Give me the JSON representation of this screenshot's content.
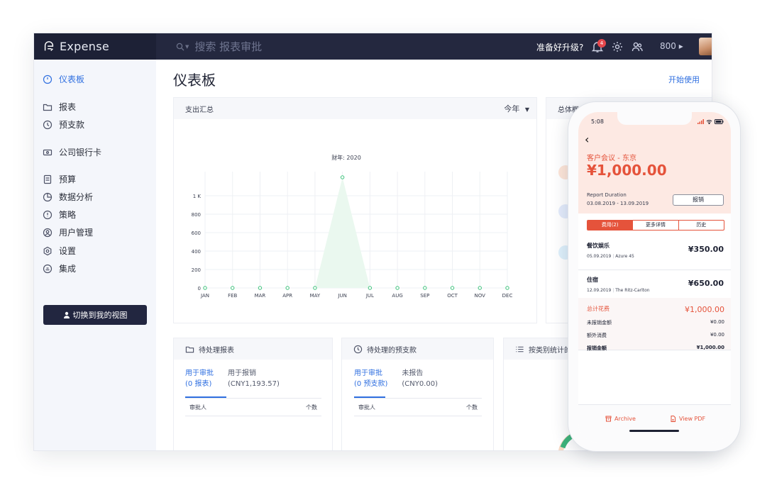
{
  "app": {
    "name": "Expense"
  },
  "topbar": {
    "search_placeholder": "搜索 报表审批",
    "upgrade_label": "准备好升级?",
    "notification_count": "4",
    "org_label": "800 ▸"
  },
  "sidebar": {
    "items": [
      {
        "label": "仪表板",
        "icon": "dashboard-icon"
      },
      {
        "label": "报表",
        "icon": "folder-icon"
      },
      {
        "label": "预支款",
        "icon": "clock-icon"
      },
      {
        "label": "公司银行卡",
        "icon": "card-icon"
      },
      {
        "label": "预算",
        "icon": "budget-icon"
      },
      {
        "label": "数据分析",
        "icon": "pie-icon"
      },
      {
        "label": "策略",
        "icon": "policy-icon"
      },
      {
        "label": "用户管理",
        "icon": "user-icon"
      },
      {
        "label": "设置",
        "icon": "gear-icon"
      },
      {
        "label": "集成",
        "icon": "integration-icon"
      }
    ],
    "switch_view_label": "切换到我的视图"
  },
  "main": {
    "title": "仪表板",
    "get_started": "开始使用",
    "spend_card": {
      "title": "支出汇总",
      "period": "今年",
      "chart_title": "财年: 2020"
    },
    "overview_card": {
      "title": "总体概"
    },
    "pending_reports": {
      "title": "待处理报表",
      "tab1_line1": "用于审批",
      "tab1_line2": "(0 报表)",
      "tab2_line1": "用于报销",
      "tab2_line2": "(CNY1,193.57)",
      "col_approver": "审批人",
      "col_count": "个数"
    },
    "pending_advances": {
      "title": "待处理的预支款",
      "tab1_line1": "用于审批",
      "tab1_line2": "(0 预支款)",
      "tab2_line1": "未报告",
      "tab2_line2": "(CNY0.00)",
      "col_approver": "审批人",
      "col_count": "个数"
    },
    "category_card": {
      "title": "按类别统计的"
    }
  },
  "chart_data": {
    "type": "area",
    "title": "财年: 2020",
    "categories": [
      "JAN",
      "FEB",
      "MAR",
      "APR",
      "MAY",
      "JUN",
      "JUL",
      "AUG",
      "SEP",
      "OCT",
      "NOV",
      "DEC"
    ],
    "values": [
      0,
      0,
      0,
      0,
      0,
      1200,
      0,
      0,
      0,
      0,
      0,
      0
    ],
    "y_ticks": [
      "0",
      "200",
      "400",
      "600",
      "800",
      "1 K"
    ],
    "ylim": [
      0,
      1200
    ],
    "grid": true,
    "series_color": "#3cc27a"
  },
  "phone": {
    "time": "5:08",
    "trip_name": "客户会议 - 东京",
    "amount": "¥1,000.00",
    "duration_label": "Report Duration",
    "duration_value": "03.08.2019 - 13.09.2019",
    "report_button": "报销",
    "tabs": [
      "费用(2)",
      "更多详情",
      "历史"
    ],
    "expenses": [
      {
        "category": "餐饮娱乐",
        "date": "05.09.2019",
        "merchant": "Azure 45",
        "amount": "¥350.00"
      },
      {
        "category": "住宿",
        "date": "12.09.2019",
        "merchant": "The Ritz-Carlton",
        "amount": "¥650.00"
      }
    ],
    "totals": [
      {
        "label": "总计花费",
        "value": "¥1,000.00"
      },
      {
        "label": "未报销金额",
        "value": "¥0.00"
      },
      {
        "label": "额外消费",
        "value": "¥0.00"
      },
      {
        "label": "报销金额",
        "value": "¥1,000.00"
      }
    ],
    "archive_label": "Archive",
    "view_pdf_label": "View PDF",
    "accent_color": "#e5533b"
  }
}
